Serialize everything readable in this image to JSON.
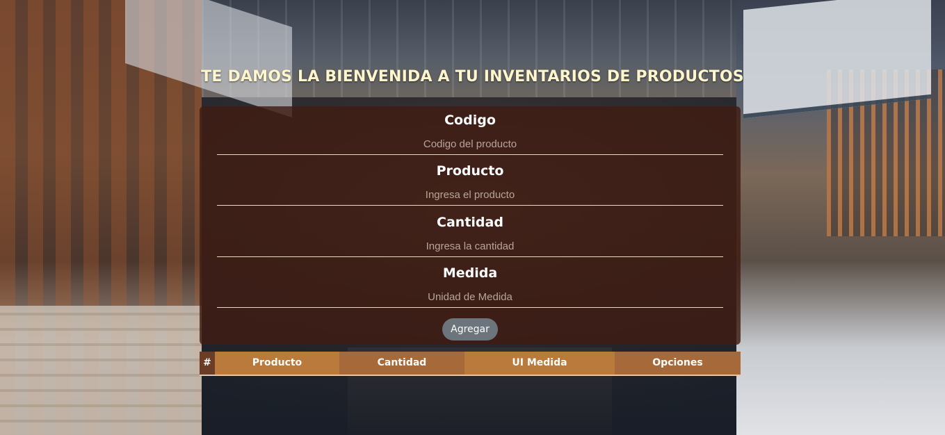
{
  "header": {
    "title": "TE DAMOS LA BIENVENIDA A TU INVENTARIOS DE PRODUCTOS"
  },
  "form": {
    "fields": [
      {
        "label": "Codigo",
        "placeholder": "Codigo del producto"
      },
      {
        "label": "Producto",
        "placeholder": "Ingresa el producto"
      },
      {
        "label": "Cantidad",
        "placeholder": "Ingresa la cantidad"
      },
      {
        "label": "Medida",
        "placeholder": "Unidad de Medida"
      }
    ],
    "submit_label": "Agregar"
  },
  "table": {
    "columns": [
      "#",
      "Producto",
      "Cantidad",
      "UI Medida",
      "Opciones"
    ],
    "rows": []
  },
  "colors": {
    "title": "#fff6cc",
    "panel": "#401c12",
    "header_primary": "#b97a3c",
    "header_secondary": "#a5693a",
    "button": "#6c747c"
  }
}
